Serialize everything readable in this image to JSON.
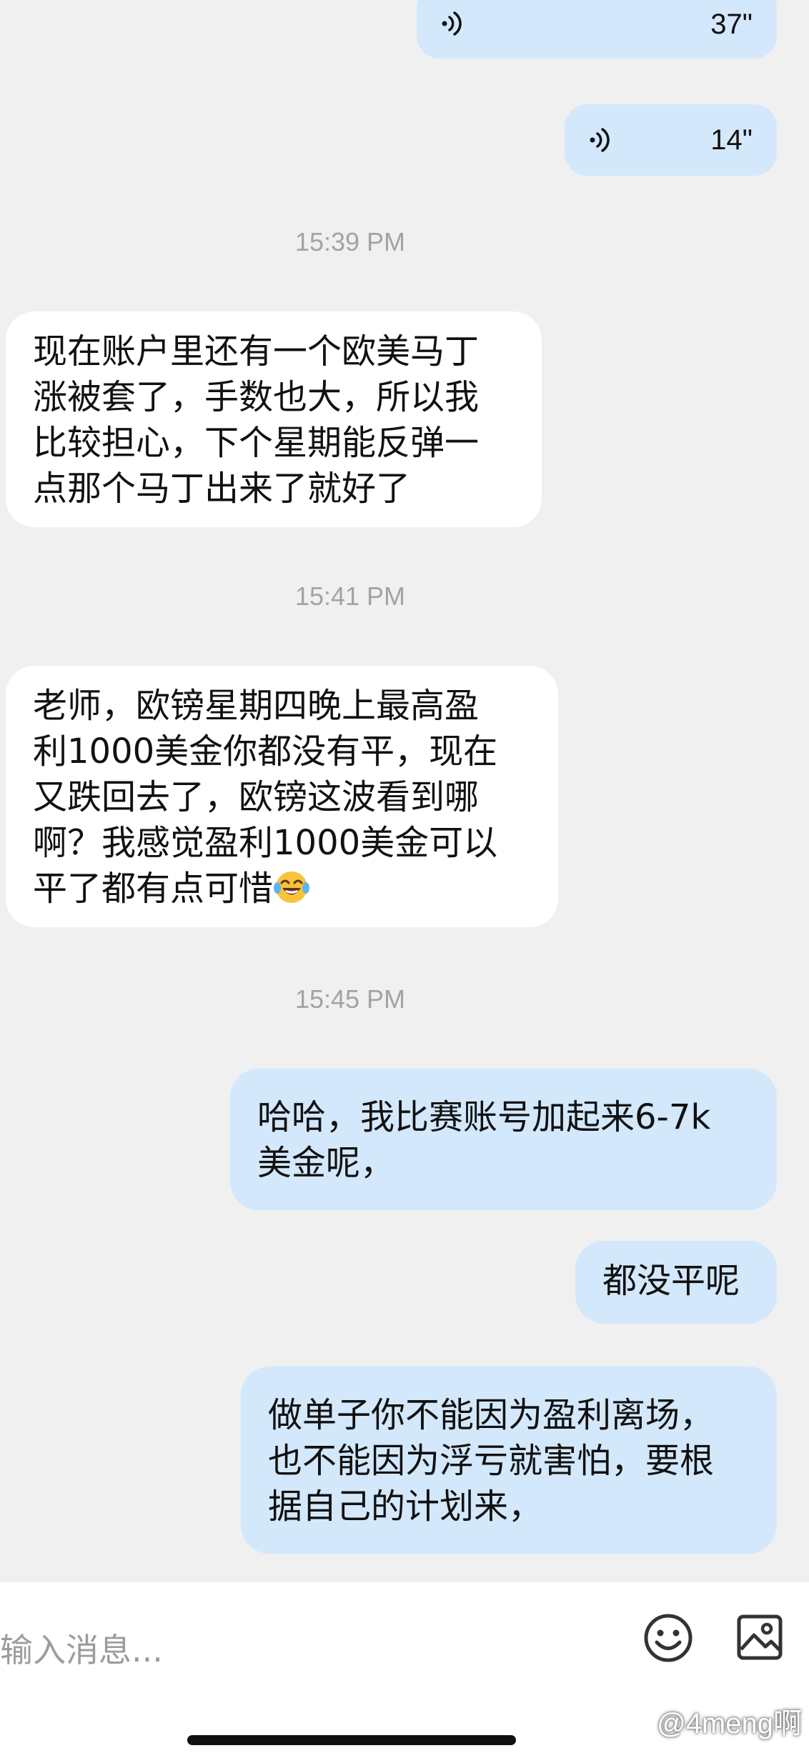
{
  "colors": {
    "background": "#f0f0f0",
    "incoming_bubble": "#ffffff",
    "outgoing_bubble": "#d3e8fb",
    "timestamp": "#a3a3a3",
    "text": "#111111"
  },
  "voice_messages": [
    {
      "icon": "voice-wave-icon",
      "duration": "37\""
    },
    {
      "icon": "voice-wave-icon",
      "duration": "14\""
    }
  ],
  "timestamps": [
    "15:39 PM",
    "15:41 PM",
    "15:45 PM"
  ],
  "messages": [
    {
      "direction": "incoming",
      "lines": [
        "现在账户里还有一个欧美马丁",
        "涨被套了，手数也大，所以我",
        "比较担心，下个星期能反弹一",
        "点那个马丁出来了就好了"
      ]
    },
    {
      "direction": "incoming",
      "lines": [
        "老师，欧镑星期四晚上最高盈",
        "利1000美金你都没有平，现在",
        "又跌回去了，欧镑这波看到哪",
        "啊？我感觉盈利1000美金可以",
        "平了都有点可惜"
      ],
      "emoji": "laughing-tears-emoji"
    },
    {
      "direction": "outgoing",
      "lines": [
        "哈哈，我比赛账号加起来6-7k",
        "美金呢，"
      ]
    },
    {
      "direction": "outgoing",
      "lines": [
        "都没平呢"
      ]
    },
    {
      "direction": "outgoing",
      "lines": [
        "做单子你不能因为盈利离场，",
        "也不能因为浮亏就害怕，要根",
        "据自己的计划来，"
      ]
    }
  ],
  "input_bar": {
    "placeholder": "输入消息...",
    "emoji_button_icon": "smiley-face-icon",
    "image_button_icon": "image-icon"
  },
  "watermark": "@4meng啊"
}
